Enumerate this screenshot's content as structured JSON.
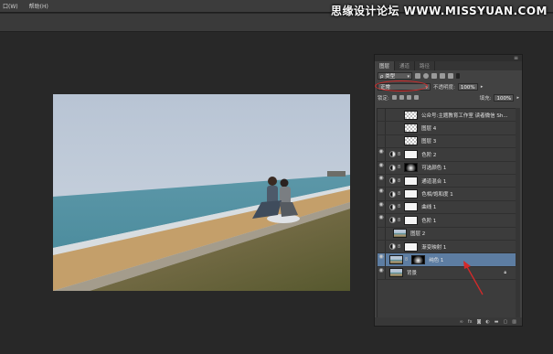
{
  "menubar": {
    "items": [
      "口(W)",
      "帮助(H)"
    ]
  },
  "watermark": "思缘设计论坛 WWW.MISSYUAN.COM",
  "panel": {
    "tabs": [
      "图层",
      "通道",
      "路径"
    ],
    "filter_kind": "ρ 类型",
    "blend_mode": "正常",
    "opacity_label": "不透明度:",
    "opacity_value": "100%",
    "lock_label": "锁定:",
    "fill_label": "填充:",
    "fill_value": "100%",
    "layers": [
      {
        "name": "公众号:主题教育工作室  读者微信 Sh...",
        "type": "pixel",
        "visible": false,
        "selected": false
      },
      {
        "name": "图层 4",
        "type": "pixel",
        "visible": false,
        "selected": false
      },
      {
        "name": "图层 3",
        "type": "pixel",
        "visible": false,
        "selected": false
      },
      {
        "name": "色阶 2",
        "type": "adjustment",
        "visible": true,
        "selected": false
      },
      {
        "name": "可选颜色 1",
        "type": "adjustment",
        "visible": true,
        "selected": false
      },
      {
        "name": "通道混合 1",
        "type": "adjustment",
        "visible": true,
        "selected": false
      },
      {
        "name": "色相/饱和度 1",
        "type": "adjustment",
        "visible": true,
        "selected": false
      },
      {
        "name": "曲线 1",
        "type": "adjustment",
        "visible": true,
        "selected": false
      },
      {
        "name": "色阶 1",
        "type": "adjustment",
        "visible": true,
        "selected": false
      },
      {
        "name": "图层 2",
        "type": "pixel",
        "visible": false,
        "selected": false
      },
      {
        "name": "渐变映射 1",
        "type": "adjustment",
        "visible": false,
        "selected": false
      },
      {
        "name": "纯色 1",
        "type": "fill",
        "visible": true,
        "selected": true
      },
      {
        "name": "背景",
        "type": "background",
        "visible": true,
        "selected": false
      }
    ],
    "footer_icons": [
      "link-icon",
      "fx-icon",
      "mask-icon",
      "adjustment-icon",
      "folder-icon",
      "new-layer-icon",
      "trash-icon"
    ]
  },
  "colors": {
    "selected_layer": "#5d7da2",
    "annotation_red": "#d42a2a"
  }
}
